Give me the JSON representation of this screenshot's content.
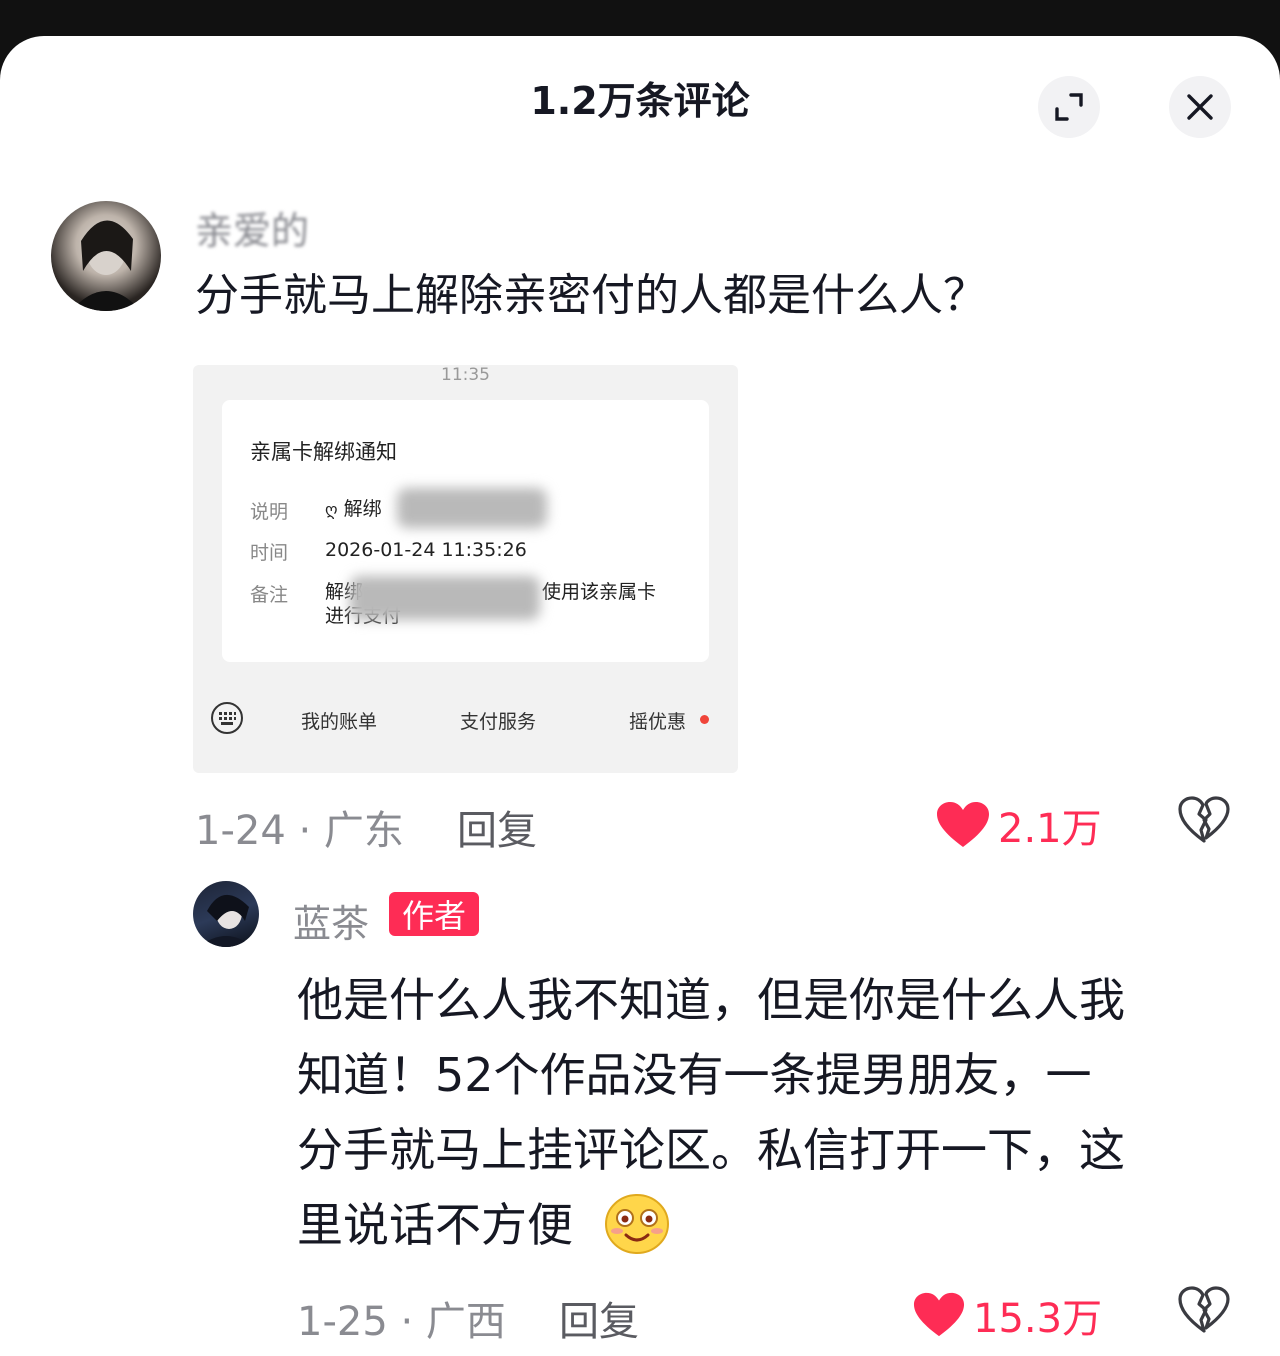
{
  "header": {
    "title": "1.2万条评论"
  },
  "comments": [
    {
      "username": "亲爱的",
      "text": "分手就马上解除亲密付的人都是什么人？",
      "date_location": "1-24 · 广东",
      "reply_label": "回复",
      "likes": "2.1万",
      "screenshot": {
        "time": "11:35",
        "title": "亲属卡解绑通知",
        "rows": [
          {
            "label": "说明",
            "value": "解绑"
          },
          {
            "label": "时间",
            "value": "2026-01-24 11:35:26"
          },
          {
            "label": "备注",
            "value": "解绑",
            "value2": "使用该亲属卡",
            "value3": "进行支付"
          }
        ],
        "tabs": [
          "我的账单",
          "支付服务",
          "摇优惠"
        ]
      }
    },
    {
      "username": "蓝茶",
      "badge": "作者",
      "text_lines": [
        "他是什么人我不知道，但是你是什么人我",
        "知道！52个作品没有一条提男朋友，一",
        "分手就马上挂评论区。私信打开一下，这",
        "里说话不方便"
      ],
      "date_location": "1-25 · 广西",
      "reply_label": "回复",
      "likes": "15.3万"
    }
  ],
  "colors": {
    "accent": "#fe2c55",
    "text": "#161823",
    "muted": "#8a8b91"
  }
}
